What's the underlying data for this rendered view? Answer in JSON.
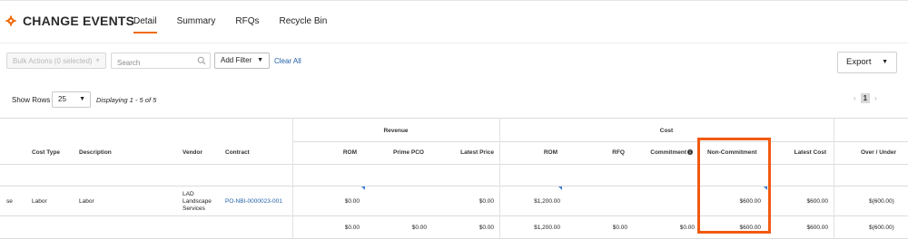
{
  "header": {
    "title": "CHANGE EVENTS",
    "tabs": [
      {
        "label": "Detail",
        "active": true
      },
      {
        "label": "Summary",
        "active": false
      },
      {
        "label": "RFQs",
        "active": false
      },
      {
        "label": "Recycle Bin",
        "active": false
      }
    ]
  },
  "toolbar": {
    "bulk_actions_label": "Bulk Actions (0 selected)",
    "search_placeholder": "Search",
    "add_filter_label": "Add Filter",
    "clear_all_label": "Clear All",
    "export_label": "Export"
  },
  "pagination": {
    "show_rows_label": "Show Rows",
    "rows_value": "25",
    "displaying_text": "Displaying 1 - 5 of 5",
    "current_page": "1"
  },
  "table": {
    "groups": {
      "revenue": "Revenue",
      "cost": "Cost"
    },
    "columns": {
      "cost_type": "Cost Type",
      "description": "Description",
      "vendor": "Vendor",
      "contract": "Contract",
      "rev_rom": "ROM",
      "prime_pco": "Prime PCO",
      "latest_price": "Latest Price",
      "cost_rom": "ROM",
      "rfq": "RFQ",
      "commitment": "Commitment",
      "non_commitment": "Non-Commitment",
      "latest_cost": "Latest Cost",
      "over_under": "Over / Under"
    },
    "row": {
      "partial": "se",
      "cost_type": "Labor",
      "description": "Labor",
      "vendor_line1": "LAD",
      "vendor_line2": "Landscape",
      "vendor_line3": "Services",
      "contract": "PO-NBI-0000023-001",
      "rev_rom": "$0.00",
      "prime_pco": "",
      "latest_price": "$0.00",
      "cost_rom": "$1,200.00",
      "rfq": "",
      "commitment": "",
      "non_commitment": "$600.00",
      "latest_cost": "$600.00",
      "over_under": "$(600.00)"
    },
    "totals": {
      "rev_rom": "$0.00",
      "prime_pco": "$0.00",
      "latest_price": "$0.00",
      "cost_rom": "$1,200.00",
      "rfq": "$0.00",
      "commitment": "$0.00",
      "non_commitment": "$600.00",
      "latest_cost": "$600.00",
      "over_under": "$(600.00)"
    }
  },
  "colors": {
    "accent": "#f06b0c",
    "highlight": "#f15a12",
    "link": "#1f5fa8"
  }
}
